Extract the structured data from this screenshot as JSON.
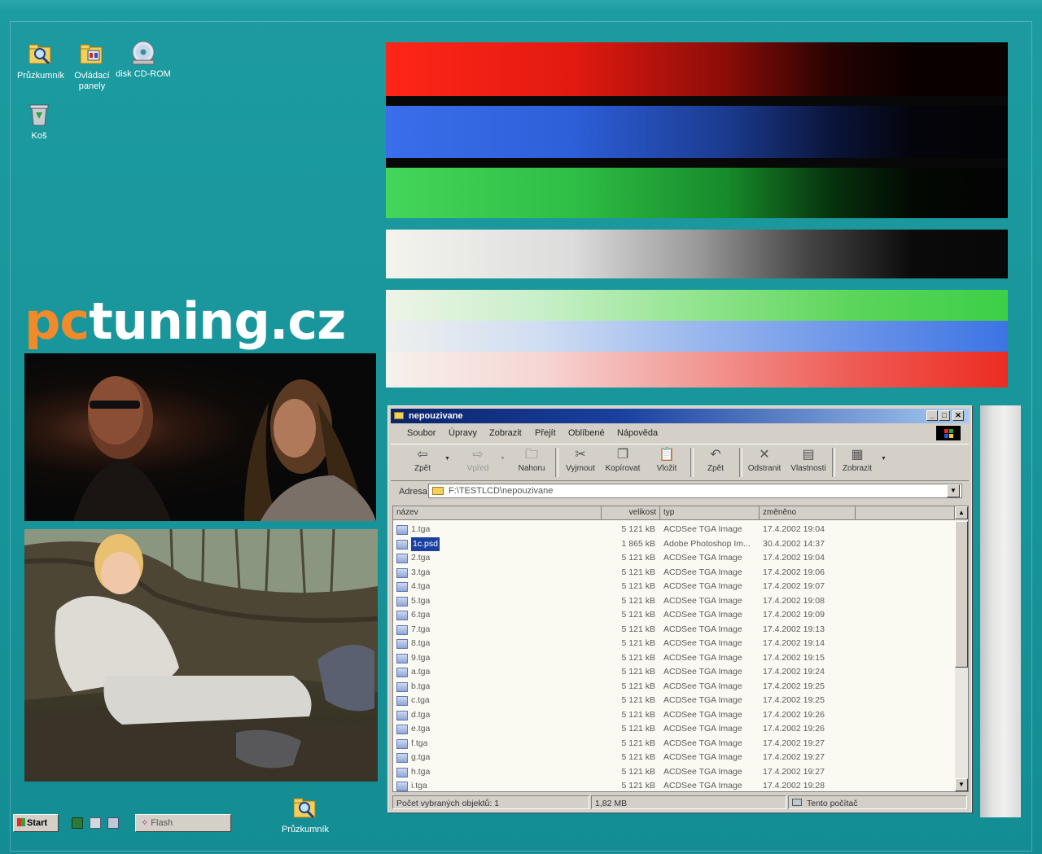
{
  "desktop": {
    "icons": [
      {
        "label": "Průzkumník",
        "icon": "explorer-icon"
      },
      {
        "label": "Ovládací panely",
        "icon": "control-panel-icon"
      },
      {
        "label": "disk CD-ROM",
        "icon": "cd-rom-icon"
      },
      {
        "label": "Koš",
        "icon": "recycle-bin-icon"
      }
    ],
    "bottom_icon": {
      "label": "Průzkumník",
      "icon": "explorer-icon"
    },
    "logo": {
      "part1": "pc",
      "part2": "tuning.cz"
    },
    "colors": {
      "background": "#1c9ba0",
      "logo_orange": "#f08a2a"
    }
  },
  "taskbar": {
    "start_label": "Start",
    "quick_launch": [
      "desktop-icon",
      "explorer-icon",
      "channels-icon"
    ],
    "task_label": "Flash"
  },
  "window": {
    "title": "nepouzivane",
    "controls": [
      "minimize",
      "maximize",
      "close"
    ],
    "menu": [
      "Soubor",
      "Úpravy",
      "Zobrazit",
      "Přejít",
      "Oblíbené",
      "Nápověda"
    ],
    "toolbar": [
      {
        "label": "Zpět",
        "icon": "back-arrow-icon"
      },
      {
        "label": "Vpřed",
        "icon": "forward-arrow-icon"
      },
      {
        "label": "Nahoru",
        "icon": "up-folder-icon"
      },
      {
        "label": "Vyjmout",
        "icon": "scissors-icon"
      },
      {
        "label": "Kopírovat",
        "icon": "copy-icon"
      },
      {
        "label": "Vložit",
        "icon": "paste-icon"
      },
      {
        "label": "Zpět",
        "icon": "undo-icon"
      },
      {
        "label": "Odstranit",
        "icon": "delete-icon"
      },
      {
        "label": "Vlastnosti",
        "icon": "properties-icon"
      },
      {
        "label": "Zobrazit",
        "icon": "views-icon"
      }
    ],
    "address_label": "Adresa",
    "address_value": "F:\\TESTLCD\\nepouzivane",
    "columns": [
      "název",
      "velikost",
      "typ",
      "změněno"
    ],
    "files": [
      {
        "name": "1.tga",
        "size": "5 121 kB",
        "type": "ACDSee TGA Image",
        "modified": "17.4.2002 19:04"
      },
      {
        "name": "1c.psd",
        "size": "1 865 kB",
        "type": "Adobe Photoshop Im...",
        "modified": "30.4.2002 14:37",
        "selected": true
      },
      {
        "name": "2.tga",
        "size": "5 121 kB",
        "type": "ACDSee TGA Image",
        "modified": "17.4.2002 19:04"
      },
      {
        "name": "3.tga",
        "size": "5 121 kB",
        "type": "ACDSee TGA Image",
        "modified": "17.4.2002 19:06"
      },
      {
        "name": "4.tga",
        "size": "5 121 kB",
        "type": "ACDSee TGA Image",
        "modified": "17.4.2002 19:07"
      },
      {
        "name": "5.tga",
        "size": "5 121 kB",
        "type": "ACDSee TGA Image",
        "modified": "17.4.2002 19:08"
      },
      {
        "name": "6.tga",
        "size": "5 121 kB",
        "type": "ACDSee TGA Image",
        "modified": "17.4.2002 19:09"
      },
      {
        "name": "7.tga",
        "size": "5 121 kB",
        "type": "ACDSee TGA Image",
        "modified": "17.4.2002 19:13"
      },
      {
        "name": "8.tga",
        "size": "5 121 kB",
        "type": "ACDSee TGA Image",
        "modified": "17.4.2002 19:14"
      },
      {
        "name": "9.tga",
        "size": "5 121 kB",
        "type": "ACDSee TGA Image",
        "modified": "17.4.2002 19:15"
      },
      {
        "name": "a.tga",
        "size": "5 121 kB",
        "type": "ACDSee TGA Image",
        "modified": "17.4.2002 19:24"
      },
      {
        "name": "b.tga",
        "size": "5 121 kB",
        "type": "ACDSee TGA Image",
        "modified": "17.4.2002 19:25"
      },
      {
        "name": "c.tga",
        "size": "5 121 kB",
        "type": "ACDSee TGA Image",
        "modified": "17.4.2002 19:25"
      },
      {
        "name": "d.tga",
        "size": "5 121 kB",
        "type": "ACDSee TGA Image",
        "modified": "17.4.2002 19:26"
      },
      {
        "name": "e.tga",
        "size": "5 121 kB",
        "type": "ACDSee TGA Image",
        "modified": "17.4.2002 19:26"
      },
      {
        "name": "f.tga",
        "size": "5 121 kB",
        "type": "ACDSee TGA Image",
        "modified": "17.4.2002 19:27"
      },
      {
        "name": "g.tga",
        "size": "5 121 kB",
        "type": "ACDSee TGA Image",
        "modified": "17.4.2002 19:27"
      },
      {
        "name": "h.tga",
        "size": "5 121 kB",
        "type": "ACDSee TGA Image",
        "modified": "17.4.2002 19:27"
      },
      {
        "name": "i.tga",
        "size": "5 121 kB",
        "type": "ACDSee TGA Image",
        "modified": "17.4.2002 19:28"
      }
    ],
    "status": {
      "selected": "Počet vybraných objektů: 1",
      "size": "1,82 MB",
      "zone": "Tento počítač"
    }
  }
}
